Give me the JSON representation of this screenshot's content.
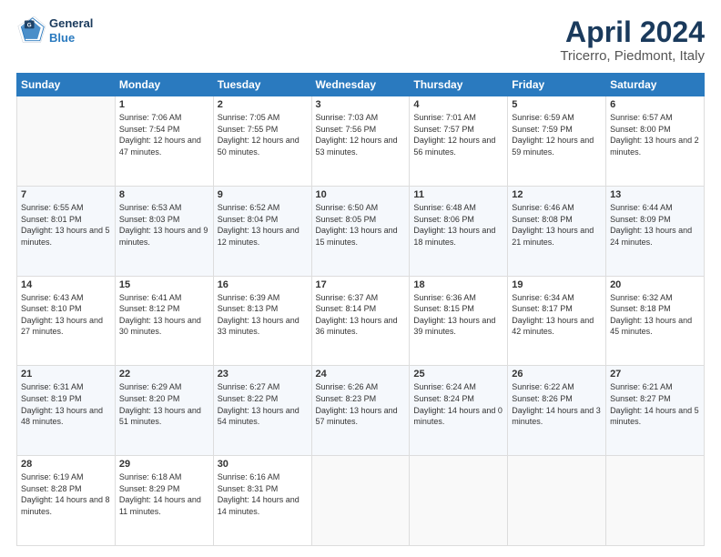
{
  "header": {
    "logo_line1": "General",
    "logo_line2": "Blue",
    "title": "April 2024",
    "subtitle": "Tricerro, Piedmont, Italy"
  },
  "columns": [
    "Sunday",
    "Monday",
    "Tuesday",
    "Wednesday",
    "Thursday",
    "Friday",
    "Saturday"
  ],
  "weeks": [
    [
      {
        "num": "",
        "empty": true
      },
      {
        "num": "1",
        "sunrise": "7:06 AM",
        "sunset": "7:54 PM",
        "daylight": "12 hours and 47 minutes."
      },
      {
        "num": "2",
        "sunrise": "7:05 AM",
        "sunset": "7:55 PM",
        "daylight": "12 hours and 50 minutes."
      },
      {
        "num": "3",
        "sunrise": "7:03 AM",
        "sunset": "7:56 PM",
        "daylight": "12 hours and 53 minutes."
      },
      {
        "num": "4",
        "sunrise": "7:01 AM",
        "sunset": "7:57 PM",
        "daylight": "12 hours and 56 minutes."
      },
      {
        "num": "5",
        "sunrise": "6:59 AM",
        "sunset": "7:59 PM",
        "daylight": "12 hours and 59 minutes."
      },
      {
        "num": "6",
        "sunrise": "6:57 AM",
        "sunset": "8:00 PM",
        "daylight": "13 hours and 2 minutes."
      }
    ],
    [
      {
        "num": "7",
        "sunrise": "6:55 AM",
        "sunset": "8:01 PM",
        "daylight": "13 hours and 5 minutes."
      },
      {
        "num": "8",
        "sunrise": "6:53 AM",
        "sunset": "8:03 PM",
        "daylight": "13 hours and 9 minutes."
      },
      {
        "num": "9",
        "sunrise": "6:52 AM",
        "sunset": "8:04 PM",
        "daylight": "13 hours and 12 minutes."
      },
      {
        "num": "10",
        "sunrise": "6:50 AM",
        "sunset": "8:05 PM",
        "daylight": "13 hours and 15 minutes."
      },
      {
        "num": "11",
        "sunrise": "6:48 AM",
        "sunset": "8:06 PM",
        "daylight": "13 hours and 18 minutes."
      },
      {
        "num": "12",
        "sunrise": "6:46 AM",
        "sunset": "8:08 PM",
        "daylight": "13 hours and 21 minutes."
      },
      {
        "num": "13",
        "sunrise": "6:44 AM",
        "sunset": "8:09 PM",
        "daylight": "13 hours and 24 minutes."
      }
    ],
    [
      {
        "num": "14",
        "sunrise": "6:43 AM",
        "sunset": "8:10 PM",
        "daylight": "13 hours and 27 minutes."
      },
      {
        "num": "15",
        "sunrise": "6:41 AM",
        "sunset": "8:12 PM",
        "daylight": "13 hours and 30 minutes."
      },
      {
        "num": "16",
        "sunrise": "6:39 AM",
        "sunset": "8:13 PM",
        "daylight": "13 hours and 33 minutes."
      },
      {
        "num": "17",
        "sunrise": "6:37 AM",
        "sunset": "8:14 PM",
        "daylight": "13 hours and 36 minutes."
      },
      {
        "num": "18",
        "sunrise": "6:36 AM",
        "sunset": "8:15 PM",
        "daylight": "13 hours and 39 minutes."
      },
      {
        "num": "19",
        "sunrise": "6:34 AM",
        "sunset": "8:17 PM",
        "daylight": "13 hours and 42 minutes."
      },
      {
        "num": "20",
        "sunrise": "6:32 AM",
        "sunset": "8:18 PM",
        "daylight": "13 hours and 45 minutes."
      }
    ],
    [
      {
        "num": "21",
        "sunrise": "6:31 AM",
        "sunset": "8:19 PM",
        "daylight": "13 hours and 48 minutes."
      },
      {
        "num": "22",
        "sunrise": "6:29 AM",
        "sunset": "8:20 PM",
        "daylight": "13 hours and 51 minutes."
      },
      {
        "num": "23",
        "sunrise": "6:27 AM",
        "sunset": "8:22 PM",
        "daylight": "13 hours and 54 minutes."
      },
      {
        "num": "24",
        "sunrise": "6:26 AM",
        "sunset": "8:23 PM",
        "daylight": "13 hours and 57 minutes."
      },
      {
        "num": "25",
        "sunrise": "6:24 AM",
        "sunset": "8:24 PM",
        "daylight": "14 hours and 0 minutes."
      },
      {
        "num": "26",
        "sunrise": "6:22 AM",
        "sunset": "8:26 PM",
        "daylight": "14 hours and 3 minutes."
      },
      {
        "num": "27",
        "sunrise": "6:21 AM",
        "sunset": "8:27 PM",
        "daylight": "14 hours and 5 minutes."
      }
    ],
    [
      {
        "num": "28",
        "sunrise": "6:19 AM",
        "sunset": "8:28 PM",
        "daylight": "14 hours and 8 minutes."
      },
      {
        "num": "29",
        "sunrise": "6:18 AM",
        "sunset": "8:29 PM",
        "daylight": "14 hours and 11 minutes."
      },
      {
        "num": "30",
        "sunrise": "6:16 AM",
        "sunset": "8:31 PM",
        "daylight": "14 hours and 14 minutes."
      },
      {
        "num": "",
        "empty": true
      },
      {
        "num": "",
        "empty": true
      },
      {
        "num": "",
        "empty": true
      },
      {
        "num": "",
        "empty": true
      }
    ]
  ],
  "labels": {
    "sunrise_prefix": "Sunrise: ",
    "sunset_prefix": "Sunset: ",
    "daylight_prefix": "Daylight: "
  }
}
